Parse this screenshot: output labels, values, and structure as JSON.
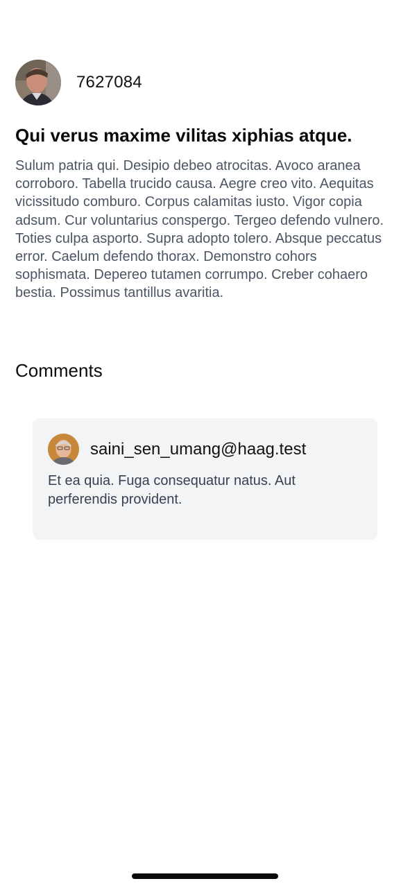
{
  "post": {
    "author": "7627084",
    "title": "Qui verus maxime vilitas xiphias atque.",
    "body": "Sulum patria qui. Desipio debeo atrocitas. Avoco aranea corroboro. Tabella trucido causa. Aegre creo vito. Aequitas vicissitudo comburo. Corpus calamitas iusto. Vigor copia adsum. Cur voluntarius conspergo. Tergeo defendo vulnero. Toties culpa asporto. Supra adopto tolero. Absque peccatus error. Caelum defendo thorax. Demonstro cohors sophismata. Depereo tutamen corrumpo. Creber cohaero bestia. Possimus tantillus avaritia."
  },
  "comments_section": {
    "heading": "Comments",
    "items": [
      {
        "author": "saini_sen_umang@haag.test",
        "text": "Et ea quia. Fuga consequatur natus. Aut perferendis provident."
      }
    ]
  },
  "colors": {
    "card_background": "#f3f4f6",
    "body_text": "#4b5563"
  }
}
